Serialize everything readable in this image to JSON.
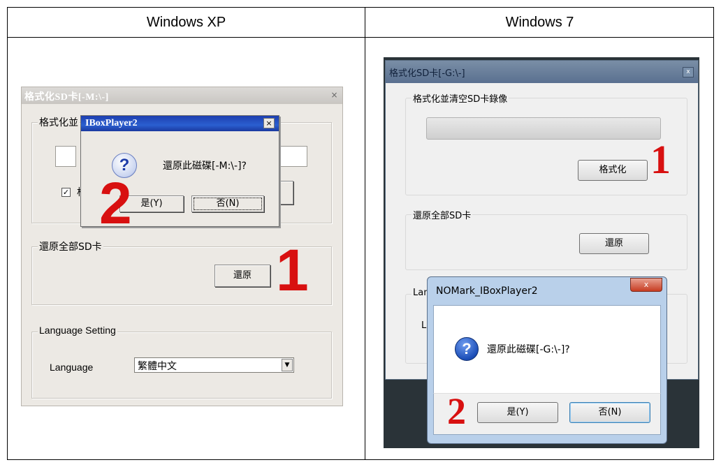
{
  "table": {
    "col1_header": "Windows XP",
    "col2_header": "Windows 7"
  },
  "xp": {
    "window_title": "格式化SD卡[-M:\\-]",
    "close_glyph": "×",
    "format_group_label": "格式化並",
    "checkbox_label": "格",
    "restore_group_label": "還原全部SD卡",
    "restore_button": "還原",
    "language_group_label": "Language Setting",
    "language_label": "Language",
    "language_value": "繁體中文",
    "dialog": {
      "title": "IBoxPlayer2",
      "close_glyph": "×",
      "message": "還原此磁碟[-M:\\-]?",
      "yes_button": "是(Y)",
      "no_button": "否(N)"
    },
    "step_1": "1",
    "step_2": "2"
  },
  "win7": {
    "window_title": "格式化SD卡[-G:\\-]",
    "close_glyph": "x",
    "format_group_label": "格式化並清空SD卡錄像",
    "format_button": "格式化",
    "restore_group_label": "還原全部SD卡",
    "restore_button": "還原",
    "lang_group_fragment": "Lan",
    "lang_label_fragment": "L",
    "dialog": {
      "title": "NOMark_IBoxPlayer2",
      "close_glyph": "x",
      "message": "還原此磁碟[-G:\\-]?",
      "yes_button": "是(Y)",
      "no_button": "否(N)"
    },
    "step_1": "1",
    "step_2": "2"
  }
}
